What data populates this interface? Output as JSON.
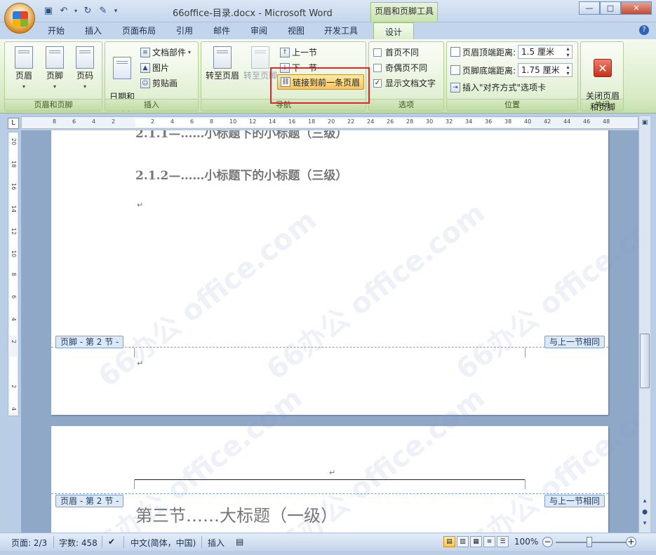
{
  "title": {
    "document": "66office-目录.docx - Microsoft Word",
    "context_tab": "页眉和页脚工具"
  },
  "window": {
    "minimize": "—",
    "maximize": "□",
    "close": "✕"
  },
  "tabs": [
    "开始",
    "插入",
    "页面布局",
    "引用",
    "邮件",
    "审阅",
    "视图",
    "开发工具",
    "设计"
  ],
  "ribbon": {
    "header_footer_group": {
      "label": "页眉和页脚",
      "header": "页眉",
      "footer": "页脚",
      "page_number": "页码"
    },
    "insert_group": {
      "label": "插入",
      "date_time": "日期和\n时间",
      "quick_parts": "文档部件",
      "picture": "图片",
      "clip_art": "剪贴画"
    },
    "navigation_group": {
      "label": "导航",
      "goto_header": "转至页眉",
      "goto_footer": "转至页脚",
      "previous": "上一节",
      "next": "下一节",
      "link_previous": "链接到前一条页眉"
    },
    "options_group": {
      "label": "选项",
      "different_first": "首页不同",
      "different_odd_even": "奇偶页不同",
      "show_doc_text": "显示文档文字",
      "show_doc_text_checked": "✓"
    },
    "position_group": {
      "label": "位置",
      "header_top_label": "页眉顶端距离:",
      "header_top_value": "1.5 厘米",
      "footer_bottom_label": "页脚底端距离:",
      "footer_bottom_value": "1.75 厘米",
      "insert_align_tab": "插入\"对齐方式\"选项卡"
    },
    "close_group": {
      "label": "关闭",
      "close_btn": "关闭页眉\n和页脚"
    }
  },
  "ruler": {
    "h_ticks": [
      "8",
      "6",
      "4",
      "2",
      "",
      "2",
      "4",
      "6",
      "8",
      "10",
      "12",
      "14",
      "16",
      "18",
      "20",
      "22",
      "24",
      "26",
      "28",
      "30",
      "32",
      "34",
      "36",
      "38",
      "40",
      "42",
      "44",
      "46",
      "48"
    ],
    "v_ticks": [
      "20",
      "18",
      "16",
      "14",
      "12",
      "10",
      "8",
      "6",
      "4",
      "2",
      "",
      "2",
      "4"
    ]
  },
  "document": {
    "heading_partial": "2.1.1—……小标题下的小标题（三级）",
    "heading_312": "2.1.2—……小标题下的小标题（三级）",
    "heading_third_section": "第三节……大标题（一级）",
    "footer_label": "页脚 - 第 2 节 -",
    "header_label": "页眉 - 第 2 节 -",
    "same_as_previous": "与上一节相同",
    "para_mark": "↵",
    "watermark": "66办公 office.com"
  },
  "statusbar": {
    "page": "页面: 2/3",
    "words": "字数: 458",
    "language": "中文(简体，中国)",
    "mode": "插入",
    "zoom": "100%"
  }
}
